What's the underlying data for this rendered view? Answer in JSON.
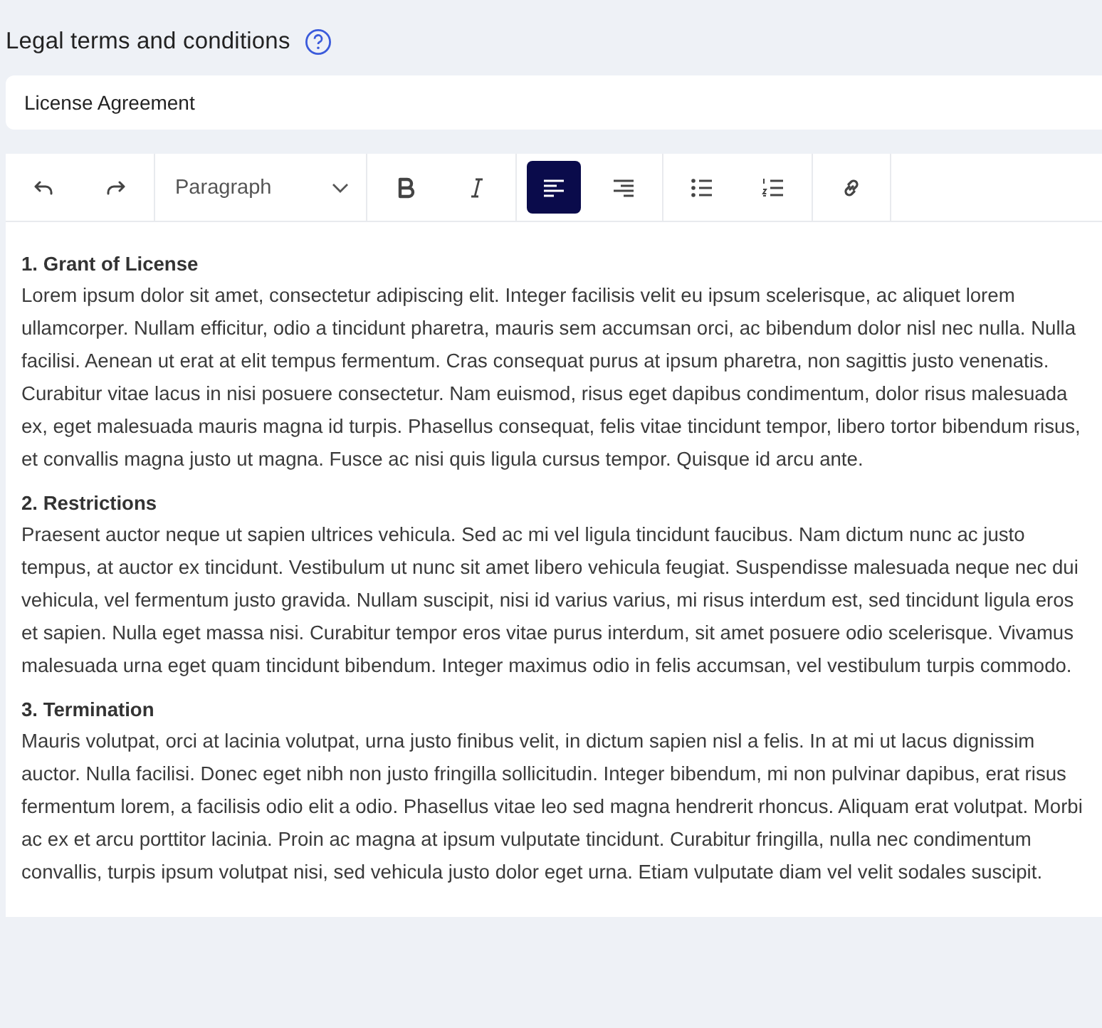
{
  "field_label": {
    "text": "Legal terms and conditions"
  },
  "title_field": {
    "value": "License Agreement"
  },
  "toolbar": {
    "groups": [
      [
        {
          "kind": "undo",
          "selected": false
        },
        {
          "kind": "redo",
          "selected": false
        }
      ],
      [
        {
          "kind": "dropdown",
          "value": "Paragraph"
        }
      ],
      [
        {
          "kind": "bold",
          "selected": false
        },
        {
          "kind": "italic",
          "selected": false
        }
      ],
      [
        {
          "kind": "align-left",
          "selected": true
        },
        {
          "kind": "align-right",
          "selected": false
        }
      ],
      [
        {
          "kind": "bullet-list",
          "selected": false
        },
        {
          "kind": "numbered-list",
          "selected": false
        }
      ],
      [
        {
          "kind": "link",
          "selected": false
        }
      ]
    ]
  },
  "sections": [
    {
      "heading": "1. Grant of License",
      "body": "Lorem ipsum dolor sit amet, consectetur adipiscing elit. Integer facilisis velit eu ipsum scelerisque, ac aliquet lorem ullamcorper. Nullam efficitur, odio a tincidunt pharetra, mauris sem accumsan orci, ac bibendum dolor nisl nec nulla. Nulla facilisi. Aenean ut erat at elit tempus fermentum. Cras consequat purus at ipsum pharetra, non sagittis justo venenatis. Curabitur vitae lacus in nisi posuere consectetur. Nam euismod, risus eget dapibus condimentum, dolor risus malesuada ex, eget malesuada mauris magna id turpis. Phasellus consequat, felis vitae tincidunt tempor, libero tortor bibendum risus, et convallis magna justo ut magna. Fusce ac nisi quis ligula cursus tempor. Quisque id arcu ante."
    },
    {
      "heading": "2. Restrictions",
      "body": "Praesent auctor neque ut sapien ultrices vehicula. Sed ac mi vel ligula tincidunt faucibus. Nam dictum nunc ac justo tempus, at auctor ex tincidunt. Vestibulum ut nunc sit amet libero vehicula feugiat. Suspendisse malesuada neque nec dui vehicula, vel fermentum justo gravida. Nullam suscipit, nisi id varius varius, mi risus interdum est, sed tincidunt ligula eros et sapien. Nulla eget massa nisi. Curabitur tempor eros vitae purus interdum, sit amet posuere odio scelerisque. Vivamus malesuada urna eget quam tincidunt bibendum. Integer maximus odio in felis accumsan, vel vestibulum turpis commodo."
    },
    {
      "heading": "3. Termination",
      "body": "Mauris volutpat, orci at lacinia volutpat, urna justo finibus velit, in dictum sapien nisl a felis. In at mi ut lacus dignissim auctor. Nulla facilisi. Donec eget nibh non justo fringilla sollicitudin. Integer bibendum, mi non pulvinar dapibus, erat risus fermentum lorem, a facilisis odio elit a odio. Phasellus vitae leo sed magna hendrerit rhoncus. Aliquam erat volutpat. Morbi ac ex et arcu porttitor lacinia. Proin ac magna at ipsum vulputate tincidunt. Curabitur fringilla, nulla nec condimentum convallis, turpis ipsum volutpat nisi, sed vehicula justo dolor eget urna. Etiam vulputate diam vel velit sodales suscipit."
    }
  ]
}
